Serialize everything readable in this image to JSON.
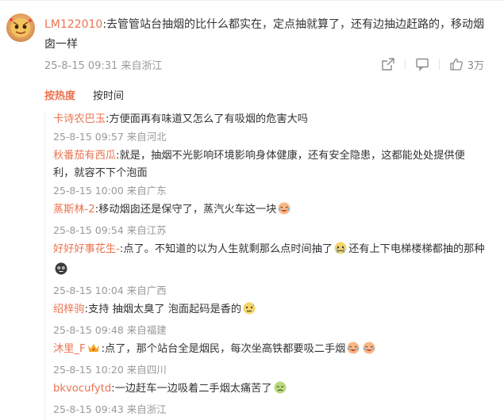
{
  "main_comment": {
    "username": "LM122010",
    "text": ":去管管站台抽烟的比什么都实在，定点抽就算了，还有边抽边赶路的，移动烟囱一样",
    "meta": "25-8-15 09:31 来自浙江",
    "like_count": "3万"
  },
  "sort_tabs": {
    "hot": "按热度",
    "time": "按时间"
  },
  "replies": [
    {
      "username": "卡诗农巴玉",
      "text": ":方便面再有味道又怎么了有吸烟的危害大吗",
      "meta": "25-8-15 09:57 来自河北"
    },
    {
      "username": "秋番茄有西瓜",
      "text": ":就是，抽烟不光影响环境影响身体健康，还有安全隐患，这都能处处提供便利，就容不下个泡面",
      "meta": "25-8-15 10:00 来自广东"
    },
    {
      "username": "蒸斯林-2",
      "text": ":移动烟囱还是保守了，蒸汽火车这一块",
      "meta": "25-8-15 09:54 来自江苏"
    },
    {
      "username": "好好好事花生-",
      "text_a": ":点了。不知道的以为人生就剩那么点时间抽了",
      "text_b": "还有上下电梯楼梯都抽的那种",
      "meta": "25-8-15 10:04 来自广西"
    },
    {
      "username": "绍梓驹",
      "text": ":支持 抽烟太臭了 泡面起码是香的",
      "meta": "25-8-15 09:48 来自福建"
    },
    {
      "username": "沐里_F",
      "text": ":点了，那个站台全是烟民，每次坐高铁都要吸二手烟",
      "meta": "25-8-15 10:20 来自四川"
    },
    {
      "username": "bkvocufytd",
      "text": ":一边赶车一边吸着二手烟太痛苦了",
      "meta": "25-8-15 09:43 来自浙江"
    }
  ],
  "icons": {
    "share": "share-icon",
    "comment": "comment-icon",
    "like": "thumb-up-icon"
  },
  "colors": {
    "username": "#eb7350",
    "meta": "#999999",
    "text": "#333333"
  }
}
